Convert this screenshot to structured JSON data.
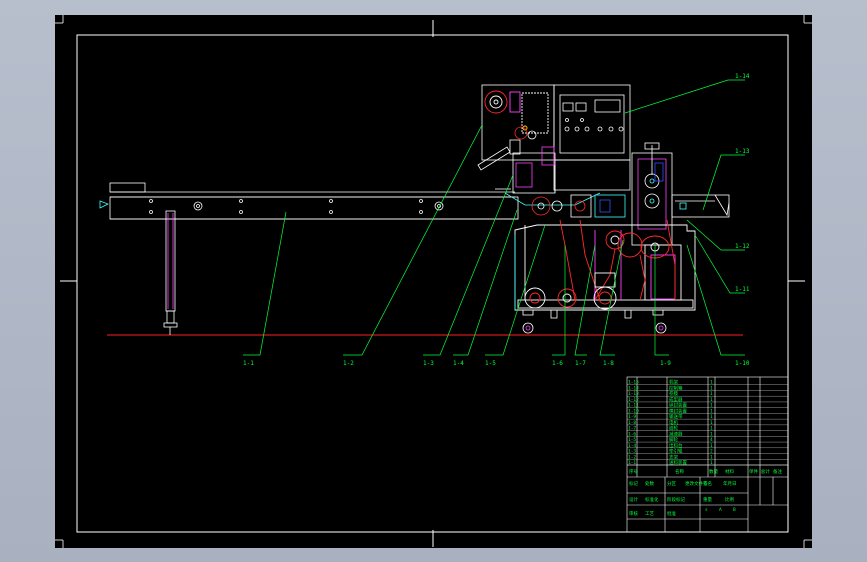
{
  "drawing": {
    "type": "side elevation assembly drawing",
    "colors": {
      "background": "#000000",
      "frame": "#ffffff",
      "leader": "#00ff3a",
      "ground_line": "#ff2020",
      "machine_red": "#ff2a2a",
      "magenta": "#ff40ff",
      "cyan": "#40ffff",
      "blue": "#3050ff"
    },
    "callouts": [
      "1-1",
      "1-2",
      "1-3",
      "1-4",
      "1-5",
      "1-6",
      "1-7",
      "1-8",
      "1-9",
      "1-10",
      "1-11",
      "1-12",
      "1-13",
      "1-14",
      "1-15"
    ],
    "panel_icons": [
      "indicator-lamp",
      "display-screen",
      "knob"
    ]
  },
  "title_block": {
    "bom_rows": [
      {
        "no": "1-15",
        "name": "机架",
        "qty": "1"
      },
      {
        "no": "1-14",
        "name": "控制箱",
        "qty": "1"
      },
      {
        "no": "1-13",
        "name": "卷膜",
        "qty": "1"
      },
      {
        "no": "1-12",
        "name": "成型器",
        "qty": "1"
      },
      {
        "no": "1-11",
        "name": "纵封装置",
        "qty": "1"
      },
      {
        "no": "1-10",
        "name": "横封装置",
        "qty": "1"
      },
      {
        "no": "1-9",
        "name": "输送带",
        "qty": "1"
      },
      {
        "no": "1-8",
        "name": "电机",
        "qty": "1"
      },
      {
        "no": "1-7",
        "name": "链轮",
        "qty": "1"
      },
      {
        "no": "1-6",
        "name": "减速器",
        "qty": "1"
      },
      {
        "no": "1-5",
        "name": "脚轮",
        "qty": "4"
      },
      {
        "no": "1-4",
        "name": "出料台",
        "qty": "1"
      },
      {
        "no": "1-3",
        "name": "牵引辊",
        "qty": "2"
      },
      {
        "no": "1-2",
        "name": "支架",
        "qty": "1"
      },
      {
        "no": "1-1",
        "name": "送料装置",
        "qty": "1"
      }
    ],
    "headers": {
      "no": "序号",
      "name": "名称",
      "qty": "数量",
      "material": "材料",
      "mass": "单件 总计",
      "remark": "备注"
    },
    "lower_block": {
      "cells": [
        "标记",
        "处数",
        "分区",
        "更改文件号",
        "签名",
        "年月日",
        "设计",
        "标准化",
        "阶段标记",
        "重量",
        "比例",
        "审核",
        "工艺",
        "批准"
      ],
      "scale_marks": [
        "s",
        "A",
        "B"
      ]
    }
  }
}
